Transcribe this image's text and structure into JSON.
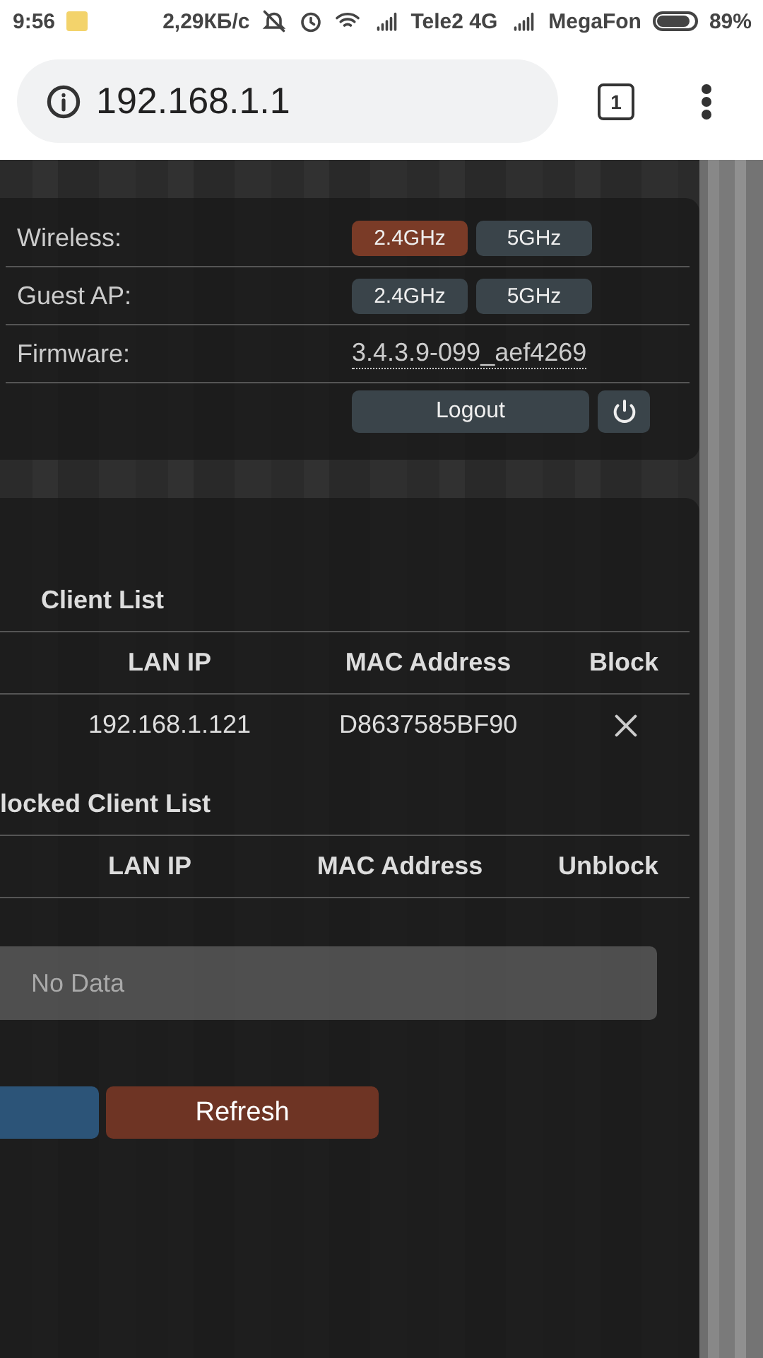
{
  "status_bar": {
    "time": "9:56",
    "speed": "2,29КБ/с",
    "carrier_1": "Tele2 4G",
    "carrier_2": "MegaFon",
    "battery": "89%"
  },
  "browser": {
    "url": "192.168.1.1",
    "tab_count": "1"
  },
  "status_panel": {
    "rows": [
      {
        "kind": "toggles",
        "label": "Wireless:",
        "options": [
          {
            "label": "2.4GHz",
            "selected": true
          },
          {
            "label": "5GHz",
            "selected": false
          }
        ]
      },
      {
        "kind": "toggles",
        "label": "Guest AP:",
        "options": [
          {
            "label": "2.4GHz",
            "selected": false
          },
          {
            "label": "5GHz",
            "selected": false
          }
        ]
      },
      {
        "kind": "link",
        "label": "Firmware:",
        "value": "3.4.3.9-099_aef4269"
      },
      {
        "kind": "logout",
        "button": "Logout"
      }
    ]
  },
  "client_list": {
    "title": "Client List",
    "columns": [
      "LAN IP",
      "MAC Address",
      "Block"
    ],
    "rows": [
      {
        "lan_ip": "192.168.1.121",
        "mac": "D8637585BF90"
      }
    ]
  },
  "blocked_client_list": {
    "title": "locked Client List",
    "columns": [
      "LAN IP",
      "MAC Address",
      "Unblock"
    ],
    "empty": "No Data"
  },
  "buttons": [
    {
      "kind": "primary"
    },
    {
      "kind": "danger",
      "label": "Refresh"
    }
  ]
}
